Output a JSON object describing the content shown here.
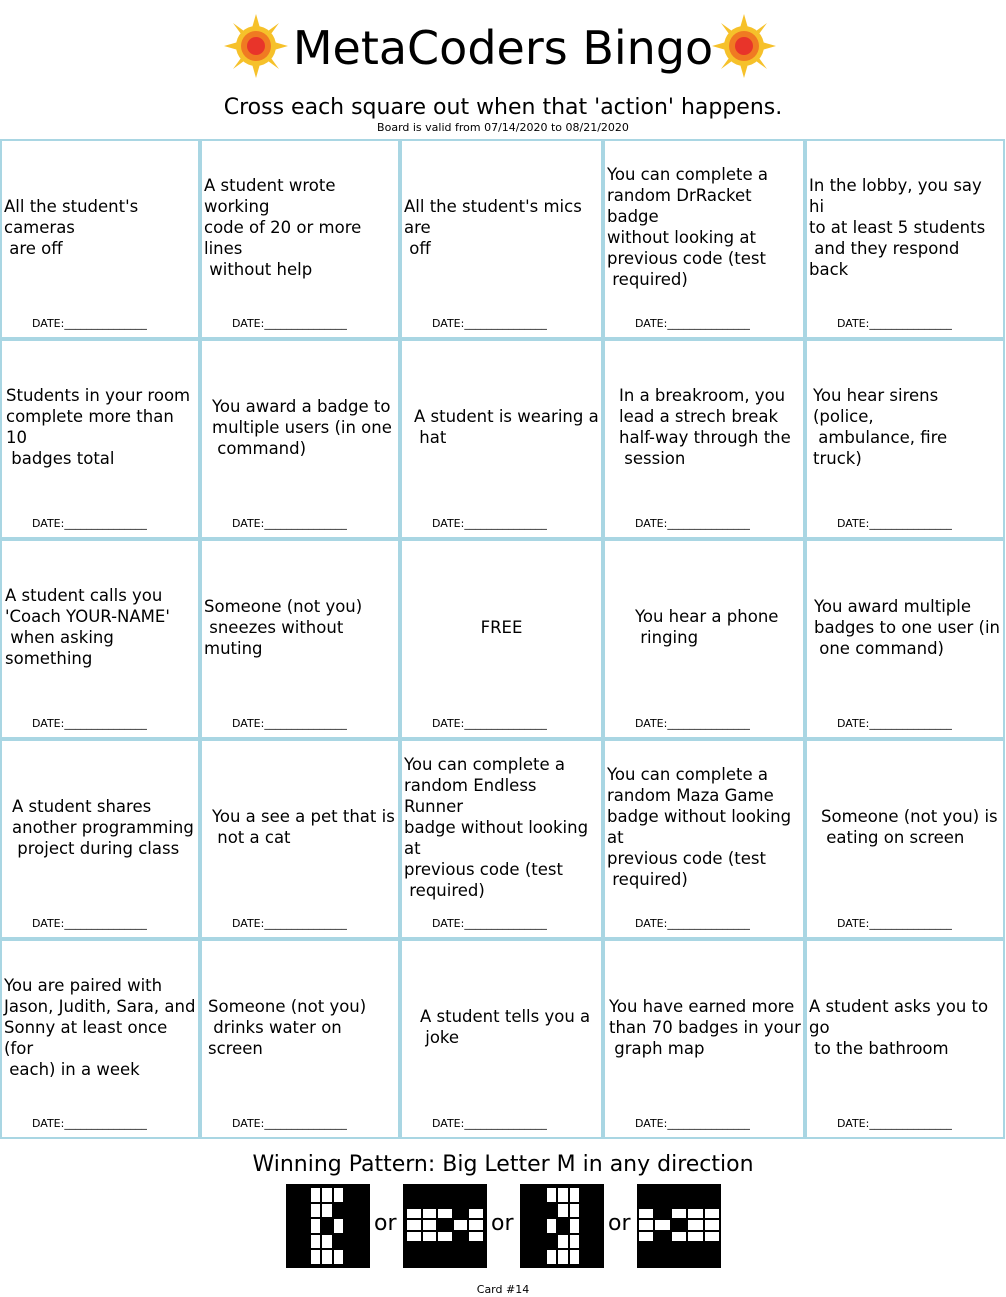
{
  "header": {
    "title": "MetaCoders Bingo",
    "subtitle": "Cross each square out when that 'action' happens.",
    "validity": "Board is valid from 07/14/2020 to 08/21/2020",
    "icon_left": "sun-icon",
    "icon_right": "sun-icon"
  },
  "board": {
    "date_label": "DATE:_______________",
    "cells": [
      [
        "All the student's cameras\n are off",
        "A student wrote working\ncode of 20 or more lines\n without help",
        "All the student's mics are\n off",
        "You can complete a\nrandom DrRacket badge\nwithout looking at\nprevious code (test\n required)",
        "In the lobby, you say hi\nto at least 5 students\n and they respond back"
      ],
      [
        "Students in your room\ncomplete more than 10\n badges total",
        "You award a badge to\nmultiple users (in one\n command)",
        "A student is wearing a\n hat",
        "In a breakroom, you\nlead a strech break\nhalf-way through the\n session",
        "You hear sirens (police,\n ambulance, fire truck)"
      ],
      [
        "A student calls you\n'Coach YOUR-NAME'\n when asking something",
        "Someone (not you)\n sneezes without muting",
        "FREE",
        "You hear a phone\n ringing",
        "You award multiple\nbadges to one user (in\n one command)"
      ],
      [
        "A student shares\nanother programming\n project during class",
        "You a see a pet that is\n not a cat",
        "You can complete a\nrandom Endless Runner\nbadge without looking at\nprevious code (test\n required)",
        "You can complete a\nrandom Maza Game\nbadge without looking at\nprevious code (test\n required)",
        "Someone (not you) is\n eating on screen"
      ],
      [
        "You are paired with\nJason, Judith, Sara, and\nSonny at least once (for\n each) in a week",
        "Someone (not you)\n drinks water on screen",
        "A student tells you a\n joke",
        "You have earned more\nthan 70 badges in your\n graph map",
        "A student asks you to go\n to the bathroom"
      ]
    ]
  },
  "footer": {
    "winning_pattern": "Winning Pattern: Big Letter M in any direction",
    "or_label": "or",
    "card_number": "Card #14",
    "patterns": [
      [
        [
          1,
          0,
          0,
          0,
          1
        ],
        [
          1,
          0,
          0,
          1,
          1
        ],
        [
          1,
          0,
          1,
          0,
          1
        ],
        [
          1,
          0,
          0,
          1,
          1
        ],
        [
          1,
          0,
          0,
          0,
          1
        ]
      ],
      [
        [
          1,
          1,
          1,
          1,
          1
        ],
        [
          0,
          0,
          0,
          1,
          0
        ],
        [
          0,
          0,
          1,
          0,
          0
        ],
        [
          0,
          0,
          0,
          1,
          0
        ],
        [
          1,
          1,
          1,
          1,
          1
        ]
      ],
      [
        [
          1,
          0,
          0,
          0,
          1
        ],
        [
          1,
          1,
          0,
          0,
          1
        ],
        [
          1,
          0,
          1,
          0,
          1
        ],
        [
          1,
          1,
          0,
          0,
          1
        ],
        [
          1,
          0,
          0,
          0,
          1
        ]
      ],
      [
        [
          1,
          1,
          1,
          1,
          1
        ],
        [
          0,
          1,
          0,
          0,
          0
        ],
        [
          0,
          0,
          1,
          0,
          0
        ],
        [
          0,
          1,
          0,
          0,
          0
        ],
        [
          1,
          1,
          1,
          1,
          1
        ]
      ]
    ]
  },
  "colors": {
    "cell_border": "#a9d6e3",
    "sun_outer": "#f6c12a",
    "sun_mid": "#f07a22",
    "sun_core": "#e8342a"
  }
}
